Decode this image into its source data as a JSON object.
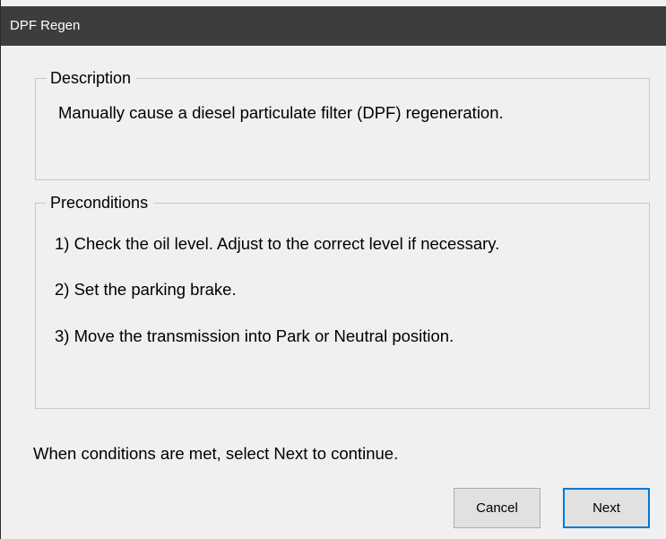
{
  "window": {
    "title": "DPF Regen"
  },
  "description": {
    "legend": "Description",
    "text": "Manually cause a diesel particulate filter (DPF) regeneration."
  },
  "preconditions": {
    "legend": "Preconditions",
    "steps": [
      "1) Check the oil level.  Adjust to the correct level if necessary.",
      "2) Set the parking brake.",
      "3) Move the transmission into Park or Neutral position."
    ]
  },
  "footer": {
    "instruction": "When conditions are met, select Next to continue.",
    "cancel_label": "Cancel",
    "next_label": "Next"
  },
  "colors": {
    "titlebar": "#3d3d3d",
    "window_bg": "#f0f0f0",
    "focus_border": "#0078d7"
  }
}
